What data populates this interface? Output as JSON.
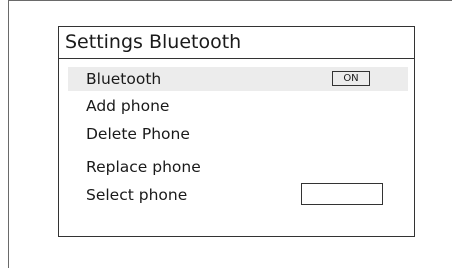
{
  "screen": {
    "title": "Settings Bluetooth"
  },
  "menu": {
    "items": [
      {
        "label": "Bluetooth",
        "selected": true
      },
      {
        "label": "Add phone"
      },
      {
        "label": "Delete Phone"
      },
      {
        "label": "Replace phone"
      },
      {
        "label": "Select phone"
      }
    ],
    "bluetooth_state": "ON",
    "selected_phone": ""
  }
}
